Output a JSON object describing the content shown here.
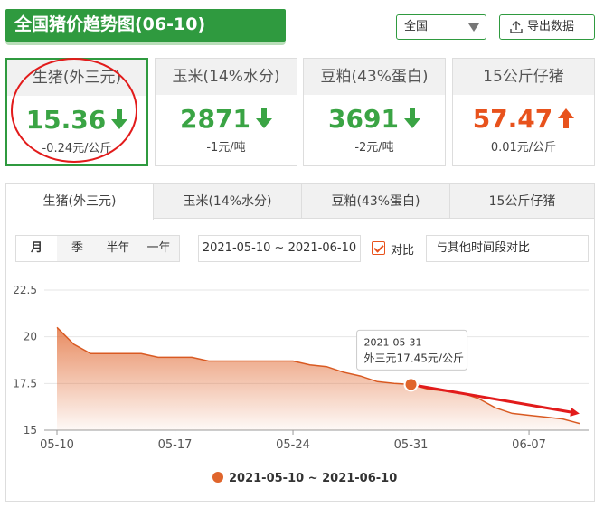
{
  "header": {
    "title": "全国猪价趋势图(06-10)",
    "region": "全国",
    "export_label": "导出数据"
  },
  "cards": [
    {
      "label": "生猪(外三元)",
      "value": "15.36",
      "trend": "down",
      "change": "-0.24元/公斤"
    },
    {
      "label": "玉米(14%水分)",
      "value": "2871",
      "trend": "down",
      "change": "-1元/吨"
    },
    {
      "label": "豆粕(43%蛋白)",
      "value": "3691",
      "trend": "down",
      "change": "-2元/吨"
    },
    {
      "label": "15公斤仔猪",
      "value": "57.47",
      "trend": "up",
      "change": "0.01元/公斤"
    }
  ],
  "tabs": [
    "生猪(外三元)",
    "玉米(14%水分)",
    "豆粕(43%蛋白)",
    "15公斤仔猪"
  ],
  "period_options": [
    "月",
    "季",
    "半年",
    "一年"
  ],
  "date_range": "2021-05-10 ~ 2021-06-10",
  "compare_label": "对比",
  "compare_placeholder": "与其他时间段对比",
  "colors": {
    "brand_green": "#2f9a3f",
    "down": "#3aa444",
    "up": "#e8521c",
    "series": "#e0652c"
  },
  "chart_data": {
    "type": "area",
    "series": [
      {
        "name": "2021-05-10 ~ 2021-06-10",
        "x": [
          "05-10",
          "05-11",
          "05-12",
          "05-13",
          "05-14",
          "05-15",
          "05-16",
          "05-17",
          "05-18",
          "05-19",
          "05-20",
          "05-21",
          "05-22",
          "05-23",
          "05-24",
          "05-25",
          "05-26",
          "05-27",
          "05-28",
          "05-29",
          "05-30",
          "05-31",
          "06-01",
          "06-02",
          "06-03",
          "06-04",
          "06-05",
          "06-06",
          "06-07",
          "06-08",
          "06-09",
          "06-10"
        ],
        "values": [
          20.5,
          19.6,
          19.1,
          19.1,
          19.1,
          19.1,
          18.9,
          18.9,
          18.9,
          18.7,
          18.7,
          18.7,
          18.7,
          18.7,
          18.7,
          18.5,
          18.4,
          18.1,
          17.9,
          17.6,
          17.5,
          17.45,
          17.2,
          17.1,
          17.0,
          16.7,
          16.2,
          15.9,
          15.8,
          15.7,
          15.6,
          15.36
        ]
      }
    ],
    "x_ticks": [
      "05-10",
      "05-17",
      "05-24",
      "05-31",
      "06-07"
    ],
    "y_ticks": [
      15,
      17.5,
      20,
      22.5
    ],
    "ylim": [
      15,
      22.5
    ],
    "tooltip": {
      "date": "2021-05-31",
      "text": "外三元17.45元/公斤"
    },
    "legend": "2021-05-10 ~ 2021-06-10",
    "grid": "horizontal"
  }
}
